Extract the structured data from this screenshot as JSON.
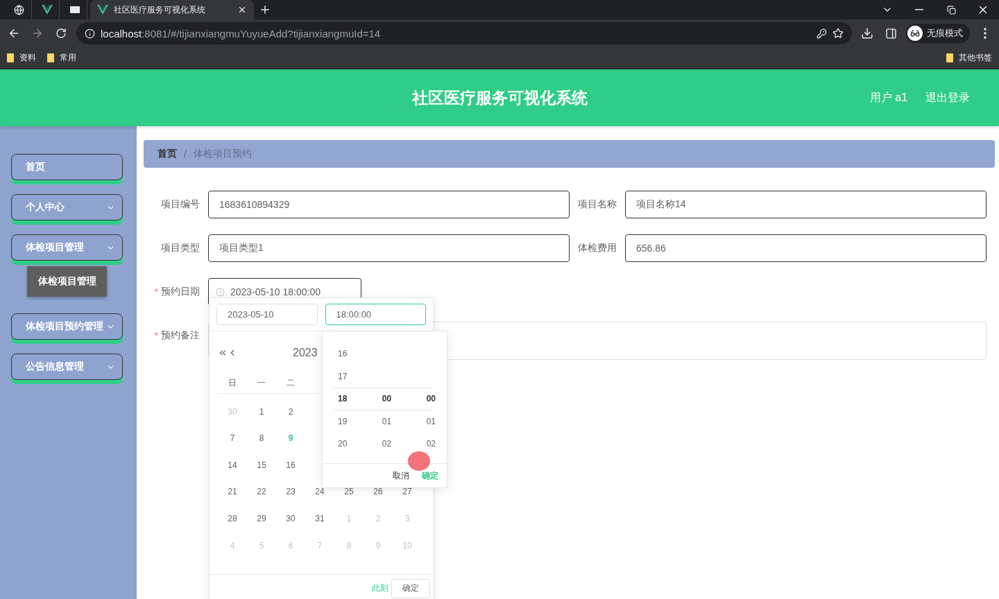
{
  "browser": {
    "tabs": [
      {
        "kind": "globe",
        "selected": false
      },
      {
        "kind": "vue",
        "selected": false
      },
      {
        "kind": "window",
        "selected": false
      },
      {
        "kind": "vue",
        "title": "社区医疗服务可视化系统",
        "selected": true
      }
    ],
    "url_host": "localhost",
    "url_rest": ":8081/#/tijianxiangmuYuyueAdd?tijianxiangmuId=14",
    "profile": "无痕模式",
    "bookmarks": [
      "资料",
      "常用"
    ],
    "other_bookmarks": "其他书签"
  },
  "header": {
    "title": "社区医疗服务可视化系统",
    "user": "用户 a1",
    "logout": "退出登录"
  },
  "sidebar": {
    "items": [
      {
        "label": "首页",
        "expandable": false
      },
      {
        "label": "个人中心",
        "expandable": true
      },
      {
        "label": "体检项目管理",
        "expandable": true,
        "children": [
          {
            "label": "体检项目管理"
          }
        ]
      },
      {
        "label": "体检项目预约管理",
        "expandable": true
      },
      {
        "label": "公告信息管理",
        "expandable": true
      }
    ]
  },
  "breadcrumb_separator": "/",
  "required_mark": "*",
  "breadcrumb": [
    {
      "label": "首页",
      "current": false
    },
    {
      "label": "体检项目预约",
      "current": true
    }
  ],
  "form": {
    "fields": [
      {
        "kind": "text",
        "label": "项目编号",
        "required": false,
        "value": "1683610894329"
      },
      {
        "kind": "text",
        "label": "项目名称",
        "required": false,
        "value": "项目名称14"
      },
      {
        "kind": "text",
        "label": "项目类型",
        "required": false,
        "value": "项目类型1"
      },
      {
        "kind": "text",
        "label": "体检费用",
        "required": false,
        "value": "656.86"
      },
      {
        "kind": "datetime",
        "label": "预约日期",
        "required": true,
        "value": "2023-05-10 18:00:00"
      },
      {
        "kind": "textarea",
        "label": "预约备注",
        "required": true
      }
    ]
  },
  "picker": {
    "date_value": "2023-05-10",
    "time_value": "18:00:00",
    "year": "2023",
    "weekdays": [
      "日",
      "一",
      "二"
    ],
    "weeks": [
      [
        {
          "day": "30",
          "kind": "muted"
        },
        {
          "day": "1",
          "kind": "normal"
        },
        {
          "day": "2",
          "kind": "normal"
        }
      ],
      [
        {
          "day": "7",
          "kind": "normal"
        },
        {
          "day": "8",
          "kind": "normal"
        },
        {
          "day": "9",
          "kind": "today"
        }
      ],
      [
        {
          "day": "14",
          "kind": "normal"
        },
        {
          "day": "15",
          "kind": "normal"
        },
        {
          "day": "16",
          "kind": "normal"
        }
      ],
      [
        {
          "day": "21",
          "kind": "normal"
        },
        {
          "day": "22",
          "kind": "normal"
        },
        {
          "day": "23",
          "kind": "normal"
        },
        {
          "day": "24",
          "kind": "normal"
        },
        {
          "day": "25",
          "kind": "normal"
        },
        {
          "day": "26",
          "kind": "normal"
        },
        {
          "day": "27",
          "kind": "normal"
        }
      ],
      [
        {
          "day": "28",
          "kind": "normal"
        },
        {
          "day": "29",
          "kind": "normal"
        },
        {
          "day": "30",
          "kind": "normal"
        },
        {
          "day": "31",
          "kind": "normal"
        },
        {
          "day": "1",
          "kind": "muted"
        },
        {
          "day": "2",
          "kind": "muted"
        },
        {
          "day": "3",
          "kind": "muted"
        }
      ],
      [
        {
          "day": "4",
          "kind": "muted"
        },
        {
          "day": "5",
          "kind": "muted"
        },
        {
          "day": "6",
          "kind": "muted"
        },
        {
          "day": "7",
          "kind": "muted"
        },
        {
          "day": "8",
          "kind": "muted"
        },
        {
          "day": "9",
          "kind": "muted"
        },
        {
          "day": "10",
          "kind": "muted"
        }
      ]
    ],
    "now": "此刻",
    "confirm": "确定",
    "time": {
      "columns": [
        [
          {
            "v": "16",
            "selected": false
          },
          {
            "v": "17",
            "selected": false
          },
          {
            "v": "18",
            "selected": true
          },
          {
            "v": "19",
            "selected": false
          },
          {
            "v": "20",
            "selected": false
          }
        ],
        [
          {
            "v": "00",
            "selected": true
          },
          {
            "v": "01",
            "selected": false
          },
          {
            "v": "02",
            "selected": false
          }
        ],
        [
          {
            "v": "00",
            "selected": true
          },
          {
            "v": "01",
            "selected": false
          },
          {
            "v": "02",
            "selected": false
          }
        ]
      ],
      "cancel": "取消",
      "confirm": "确定"
    }
  }
}
